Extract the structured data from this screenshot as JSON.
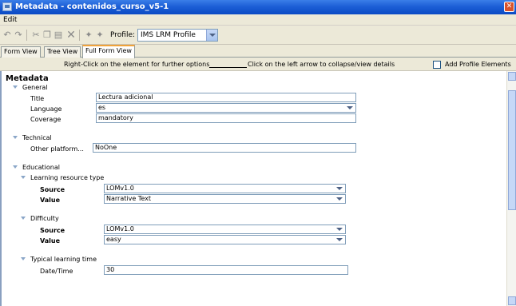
{
  "window": {
    "title": "Metadata - contenidos_curso_v5-1"
  },
  "menubar": {
    "items": [
      "Edit"
    ]
  },
  "toolbar": {
    "buttons": [
      "undo-icon",
      "redo-icon",
      "cut-icon",
      "copy-icon",
      "paste-icon",
      "delete-icon",
      "move-up-icon",
      "move-down-icon"
    ],
    "profile_label": "Profile:",
    "profile_value": "IMS LRM Profile"
  },
  "tabs": [
    "Form View",
    "Tree View",
    "Full Form View"
  ],
  "active_tab": "Full Form View",
  "hint": {
    "left": "Right-Click on the element for further options",
    "right": "Click on the left arrow to collapse/view details",
    "add_profile_label": "Add Profile Elements",
    "add_profile_checked": false
  },
  "metadata": {
    "heading": "Metadata",
    "general": {
      "label": "General",
      "title_label": "Title",
      "title_value": "Lectura adicional",
      "language_label": "Language",
      "language_value": "es",
      "coverage_label": "Coverage",
      "coverage_value": "mandatory"
    },
    "technical": {
      "label": "Technical",
      "other_platform_label": "Other platform...",
      "other_platform_value": "NoOne"
    },
    "educational": {
      "label": "Educational",
      "learning_resource_type": {
        "label": "Learning resource type",
        "source_label": "Source",
        "source_value": "LOMv1.0",
        "value_label": "Value",
        "value_value": "Narrative Text"
      },
      "difficulty": {
        "label": "Difficulty",
        "source_label": "Source",
        "source_value": "LOMv1.0",
        "value_label": "Value",
        "value_value": "easy"
      },
      "typical_learning_time": {
        "label": "Typical learning time",
        "datetime_label": "Date/Time",
        "datetime_value": "30"
      }
    }
  }
}
